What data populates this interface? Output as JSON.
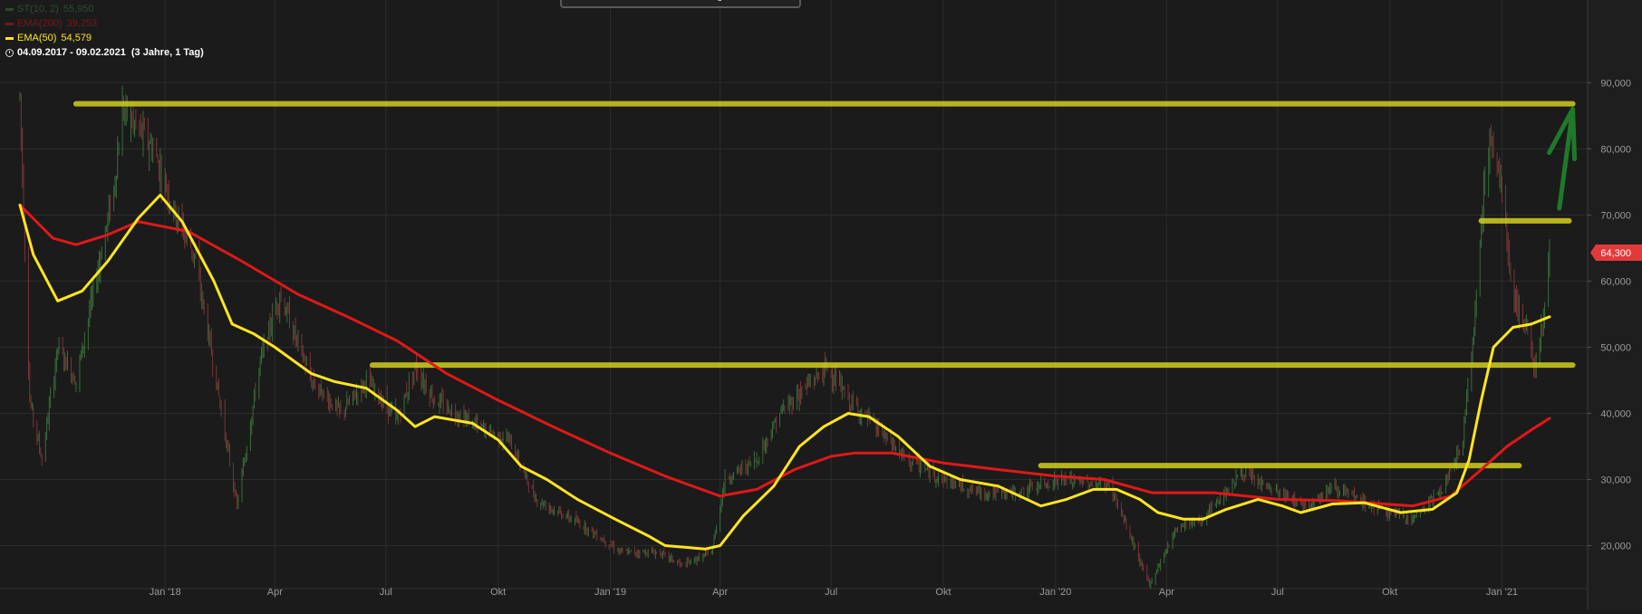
{
  "legend": {
    "st": {
      "label": "ST(10, 2)",
      "value": "55,950",
      "color": "#3d8a3d"
    },
    "ema200": {
      "label": "EMA(200)",
      "value": "39,253",
      "color": "#e01818"
    },
    "ema50": {
      "label": "EMA(50)",
      "value": "54,579",
      "color": "#ffe51f"
    },
    "period": "04.09.2017 - 09.02.2021",
    "period_detail": "(3 Jahre, 1 Tag)"
  },
  "colors": {
    "background": "#1b1b1b",
    "grid": "#2c2c2c",
    "ema200": "#e01818",
    "ema50": "#ffe51f",
    "highlight": "#d8d51e",
    "arrow": "#1e7a2a",
    "price_tag": "#e23a3a",
    "axis_text": "#9a9a9a"
  },
  "price_tag": {
    "value": 64.3,
    "label": "64,300"
  },
  "chart_data": {
    "type": "line",
    "x": [
      "2017-09-04",
      "2021-02-09"
    ],
    "xticks": [
      {
        "date": "2018-01-01",
        "label": "Jan '18"
      },
      {
        "date": "2018-04-01",
        "label": "Apr"
      },
      {
        "date": "2018-07-01",
        "label": "Jul"
      },
      {
        "date": "2018-10-01",
        "label": "Okt"
      },
      {
        "date": "2019-01-01",
        "label": "Jan '19"
      },
      {
        "date": "2019-04-01",
        "label": "Apr"
      },
      {
        "date": "2019-07-01",
        "label": "Jul"
      },
      {
        "date": "2019-10-01",
        "label": "Okt"
      },
      {
        "date": "2020-01-01",
        "label": "Jan '20"
      },
      {
        "date": "2020-04-01",
        "label": "Apr"
      },
      {
        "date": "2020-07-01",
        "label": "Jul"
      },
      {
        "date": "2020-10-01",
        "label": "Okt"
      },
      {
        "date": "2021-01-01",
        "label": "Jan '21"
      }
    ],
    "yticks": [
      {
        "value": 20,
        "label": "20,000"
      },
      {
        "value": 30,
        "label": "30,000"
      },
      {
        "value": 40,
        "label": "40,000"
      },
      {
        "value": 50,
        "label": "50,000"
      },
      {
        "value": 60,
        "label": "60,000"
      },
      {
        "value": 70,
        "label": "70,000"
      },
      {
        "value": 80,
        "label": "80,000"
      },
      {
        "value": 90,
        "label": "90,000"
      }
    ],
    "ylim": [
      13.5,
      102.5
    ],
    "grid": true,
    "series": [
      {
        "name": "EMA(200)",
        "color": "#e01818",
        "points": [
          [
            "2017-09-04",
            71.5
          ],
          [
            "2017-10-01",
            66.5
          ],
          [
            "2017-10-20",
            65.5
          ],
          [
            "2017-11-15",
            67
          ],
          [
            "2017-12-10",
            69
          ],
          [
            "2018-01-20",
            67.5
          ],
          [
            "2018-03-05",
            63
          ],
          [
            "2018-04-20",
            58
          ],
          [
            "2018-06-01",
            54.5
          ],
          [
            "2018-07-10",
            51
          ],
          [
            "2018-08-20",
            46
          ],
          [
            "2018-10-01",
            42
          ],
          [
            "2018-11-15",
            38
          ],
          [
            "2019-01-01",
            34
          ],
          [
            "2019-02-15",
            30.5
          ],
          [
            "2019-04-01",
            27.5
          ],
          [
            "2019-05-01",
            28.5
          ],
          [
            "2019-06-01",
            31.5
          ],
          [
            "2019-07-01",
            33.5
          ],
          [
            "2019-07-20",
            34
          ],
          [
            "2019-08-20",
            34
          ],
          [
            "2019-10-01",
            32.5
          ],
          [
            "2019-11-15",
            31.5
          ],
          [
            "2020-01-01",
            30.5
          ],
          [
            "2020-02-10",
            30
          ],
          [
            "2020-03-20",
            28
          ],
          [
            "2020-05-10",
            28
          ],
          [
            "2020-07-01",
            27
          ],
          [
            "2020-08-20",
            26.8
          ],
          [
            "2020-10-20",
            26
          ],
          [
            "2020-11-20",
            27.5
          ],
          [
            "2020-12-15",
            31.5
          ],
          [
            "2021-01-05",
            35
          ],
          [
            "2021-01-25",
            37.5
          ],
          [
            "2021-02-09",
            39.25
          ]
        ]
      },
      {
        "name": "EMA(50)",
        "color": "#ffe51f",
        "points": [
          [
            "2017-09-04",
            71.5
          ],
          [
            "2017-09-15",
            64
          ],
          [
            "2017-10-05",
            57
          ],
          [
            "2017-10-25",
            58.5
          ],
          [
            "2017-11-15",
            63
          ],
          [
            "2017-12-10",
            69.5
          ],
          [
            "2017-12-28",
            73
          ],
          [
            "2018-01-15",
            69
          ],
          [
            "2018-02-10",
            60
          ],
          [
            "2018-02-25",
            53.5
          ],
          [
            "2018-03-15",
            52
          ],
          [
            "2018-04-01",
            50
          ],
          [
            "2018-05-01",
            46
          ],
          [
            "2018-05-20",
            44.8
          ],
          [
            "2018-06-15",
            43.8
          ],
          [
            "2018-07-10",
            40.5
          ],
          [
            "2018-07-25",
            38
          ],
          [
            "2018-08-10",
            39.5
          ],
          [
            "2018-09-10",
            38.5
          ],
          [
            "2018-10-01",
            36
          ],
          [
            "2018-10-20",
            32
          ],
          [
            "2018-11-10",
            30
          ],
          [
            "2018-12-05",
            27
          ],
          [
            "2019-01-05",
            24
          ],
          [
            "2019-02-01",
            21.5
          ],
          [
            "2019-02-15",
            20
          ],
          [
            "2019-03-20",
            19.5
          ],
          [
            "2019-04-01",
            20
          ],
          [
            "2019-04-20",
            24.5
          ],
          [
            "2019-05-15",
            29
          ],
          [
            "2019-06-05",
            35
          ],
          [
            "2019-06-25",
            38
          ],
          [
            "2019-07-15",
            40
          ],
          [
            "2019-08-01",
            39.5
          ],
          [
            "2019-08-25",
            36.5
          ],
          [
            "2019-09-20",
            32
          ],
          [
            "2019-10-15",
            30
          ],
          [
            "2019-11-15",
            29
          ],
          [
            "2019-12-20",
            26
          ],
          [
            "2020-01-10",
            27
          ],
          [
            "2020-02-01",
            28.5
          ],
          [
            "2020-02-20",
            28.5
          ],
          [
            "2020-03-10",
            27
          ],
          [
            "2020-03-25",
            25
          ],
          [
            "2020-04-15",
            24
          ],
          [
            "2020-05-01",
            24
          ],
          [
            "2020-05-20",
            25.5
          ],
          [
            "2020-06-15",
            27
          ],
          [
            "2020-07-05",
            26
          ],
          [
            "2020-07-20",
            25
          ],
          [
            "2020-08-15",
            26.3
          ],
          [
            "2020-09-10",
            26.5
          ],
          [
            "2020-10-10",
            25
          ],
          [
            "2020-11-05",
            25.5
          ],
          [
            "2020-11-25",
            28
          ],
          [
            "2020-12-05",
            33
          ],
          [
            "2020-12-15",
            42
          ],
          [
            "2020-12-25",
            50
          ],
          [
            "2021-01-10",
            53
          ],
          [
            "2021-01-25",
            53.5
          ],
          [
            "2021-02-09",
            54.6
          ]
        ]
      }
    ],
    "price_path": [
      [
        "2017-09-04",
        88
      ],
      [
        "2017-09-12",
        42
      ],
      [
        "2017-09-22",
        33
      ],
      [
        "2017-10-05",
        50
      ],
      [
        "2017-10-20",
        45
      ],
      [
        "2017-11-05",
        60
      ],
      [
        "2017-11-20",
        74
      ],
      [
        "2017-11-27",
        86
      ],
      [
        "2017-12-10",
        83
      ],
      [
        "2017-12-22",
        80
      ],
      [
        "2018-01-10",
        70
      ],
      [
        "2018-01-25",
        64
      ],
      [
        "2018-02-10",
        47
      ],
      [
        "2018-03-01",
        26
      ],
      [
        "2018-03-20",
        48
      ],
      [
        "2018-04-05",
        58
      ],
      [
        "2018-05-01",
        45
      ],
      [
        "2018-05-25",
        40
      ],
      [
        "2018-06-15",
        45
      ],
      [
        "2018-07-10",
        39
      ],
      [
        "2018-07-25",
        47
      ],
      [
        "2018-08-10",
        42
      ],
      [
        "2018-09-15",
        38
      ],
      [
        "2018-10-10",
        36
      ],
      [
        "2018-11-01",
        27
      ],
      [
        "2018-12-10",
        23
      ],
      [
        "2019-01-10",
        19
      ],
      [
        "2019-02-10",
        19
      ],
      [
        "2019-03-01",
        17
      ],
      [
        "2019-03-25",
        19
      ],
      [
        "2019-04-05",
        30
      ],
      [
        "2019-05-01",
        33
      ],
      [
        "2019-05-20",
        40
      ],
      [
        "2019-06-10",
        44
      ],
      [
        "2019-06-28",
        47
      ],
      [
        "2019-07-15",
        42
      ],
      [
        "2019-08-01",
        39
      ],
      [
        "2019-09-01",
        33
      ],
      [
        "2019-10-01",
        30
      ],
      [
        "2019-11-01",
        28
      ],
      [
        "2019-12-01",
        28
      ],
      [
        "2020-01-05",
        30
      ],
      [
        "2020-02-15",
        29
      ],
      [
        "2020-03-18",
        14
      ],
      [
        "2020-04-10",
        23
      ],
      [
        "2020-05-01",
        24
      ],
      [
        "2020-06-01",
        31
      ],
      [
        "2020-07-01",
        28
      ],
      [
        "2020-07-25",
        26
      ],
      [
        "2020-08-15",
        29
      ],
      [
        "2020-09-15",
        26
      ],
      [
        "2020-10-20",
        24
      ],
      [
        "2020-11-15",
        29
      ],
      [
        "2020-11-30",
        36
      ],
      [
        "2020-12-10",
        55
      ],
      [
        "2020-12-20",
        82
      ],
      [
        "2020-12-31",
        75
      ],
      [
        "2021-01-10",
        58
      ],
      [
        "2021-01-22",
        52
      ],
      [
        "2021-01-28",
        47
      ],
      [
        "2021-02-04",
        55
      ],
      [
        "2021-02-09",
        64.3
      ]
    ],
    "annotations": [
      {
        "type": "hline",
        "value": 86.8,
        "from": "2017-10-20",
        "to": "2021-02-28",
        "color": "#d8d51e"
      },
      {
        "type": "hline",
        "value": 47.3,
        "from": "2018-06-20",
        "to": "2021-02-28",
        "color": "#d8d51e"
      },
      {
        "type": "hline",
        "value": 69.1,
        "from": "2020-12-15",
        "to": "2021-02-25",
        "color": "#d8d51e"
      },
      {
        "type": "hline",
        "value": 32.1,
        "from": "2019-12-20",
        "to": "2021-01-15",
        "color": "#d8d51e"
      },
      {
        "type": "arrow",
        "from": [
          "2021-02-17",
          71
        ],
        "to": [
          "2021-02-28",
          86
        ],
        "color": "#1e7a2a"
      }
    ]
  }
}
